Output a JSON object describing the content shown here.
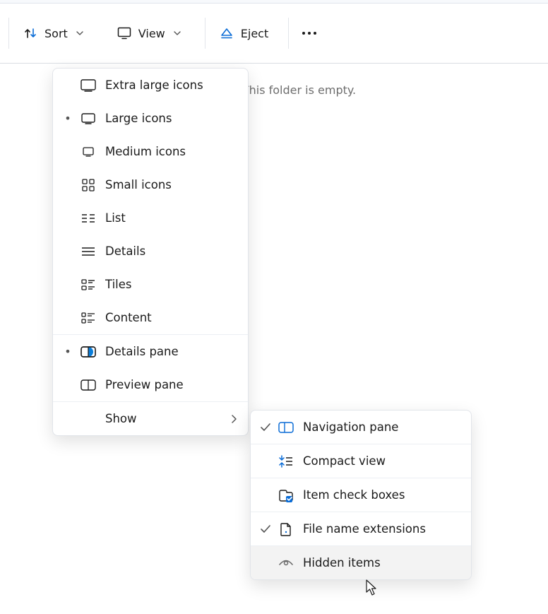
{
  "toolbar": {
    "sort_label": "Sort",
    "view_label": "View",
    "eject_label": "Eject"
  },
  "content": {
    "empty_msg": "This folder is empty."
  },
  "view_menu": {
    "extra_large": "Extra large icons",
    "large": "Large icons",
    "medium": "Medium icons",
    "small": "Small icons",
    "list": "List",
    "details": "Details",
    "tiles": "Tiles",
    "content": "Content",
    "details_pane": "Details pane",
    "preview_pane": "Preview pane",
    "show": "Show"
  },
  "show_menu": {
    "nav_pane": "Navigation pane",
    "compact": "Compact view",
    "checkboxes": "Item check boxes",
    "extensions": "File name extensions",
    "hidden": "Hidden items"
  }
}
